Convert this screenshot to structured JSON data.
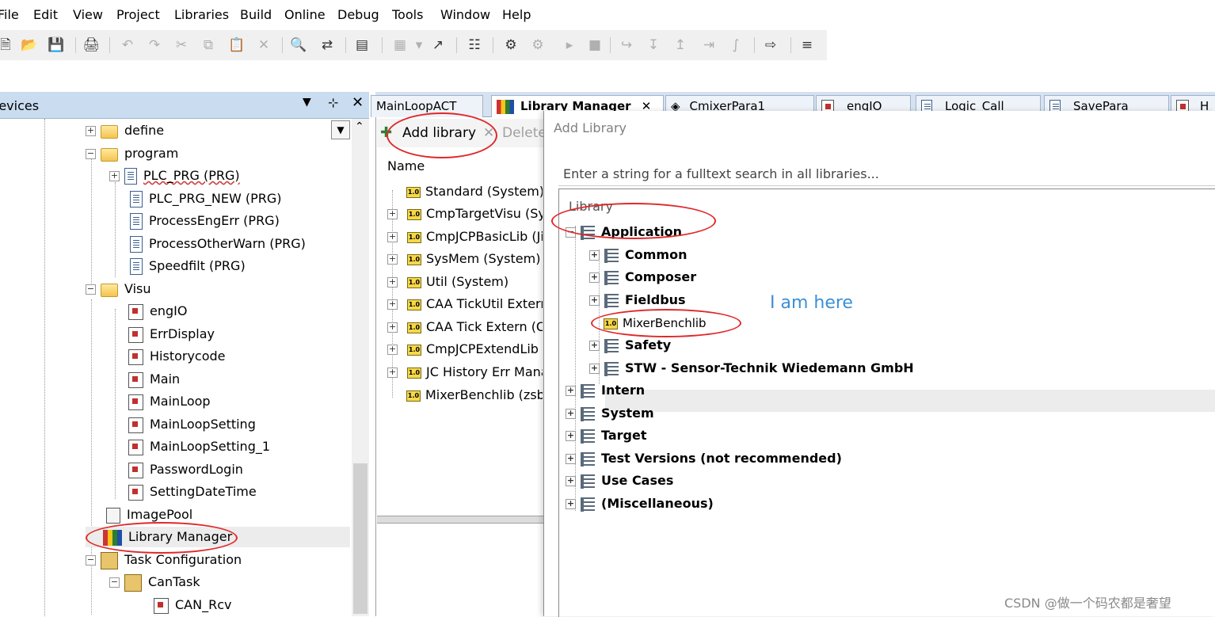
{
  "menubar": {
    "items": [
      "File",
      "Edit",
      "View",
      "Project",
      "Libraries",
      "Build",
      "Online",
      "Debug",
      "Tools",
      "Window",
      "Help"
    ]
  },
  "devices_panel": {
    "title": "Devices",
    "items": [
      {
        "label": "define"
      },
      {
        "label": "program"
      },
      {
        "label": "PLC_PRG (PRG)"
      },
      {
        "label": "PLC_PRG_NEW (PRG)"
      },
      {
        "label": "ProcessEngErr (PRG)"
      },
      {
        "label": "ProcessOtherWarn (PRG)"
      },
      {
        "label": "Speedfilt (PRG)"
      },
      {
        "label": "Visu"
      },
      {
        "label": "engIO"
      },
      {
        "label": "ErrDisplay"
      },
      {
        "label": "Historycode"
      },
      {
        "label": "Main"
      },
      {
        "label": "MainLoop"
      },
      {
        "label": "MainLoopSetting"
      },
      {
        "label": "MainLoopSetting_1"
      },
      {
        "label": "PasswordLogin"
      },
      {
        "label": "SettingDateTime"
      },
      {
        "label": "ImagePool"
      },
      {
        "label": "Library Manager"
      },
      {
        "label": "Task Configuration"
      },
      {
        "label": "CanTask"
      },
      {
        "label": "CAN_Rcv"
      }
    ]
  },
  "editor_tabs": [
    "MainLoopACT",
    "Library Manager",
    "CmixerPara1",
    "engIO",
    "Logic_Call",
    "SavePara",
    "H"
  ],
  "library_manager": {
    "add_label": "Add library",
    "delete_label": "Delete",
    "column_name": "Name",
    "libraries": [
      "Standard (System)",
      "CmpTargetVisu (Sys",
      "CmpJCPBasicLib (Jia",
      "SysMem (System)",
      "Util (System)",
      "CAA TickUtil Extern",
      "CAA Tick Extern (CA",
      "CmpJCPExtendLib (",
      "JC History Err Mana",
      "MixerBenchlib (zsb)"
    ]
  },
  "add_library_dialog": {
    "title": "Add Library",
    "search_placeholder": "Enter a string for a fulltext search in all libraries...",
    "tree_header": "Library",
    "groups": {
      "application": "Application",
      "common": "Common",
      "composer": "Composer",
      "fieldbus": "Fieldbus",
      "mixerbenchlib": "MixerBenchlib",
      "safety": "Safety",
      "stw": "STW - Sensor-Technik Wiedemann GmbH",
      "intern": "Intern",
      "system": "System",
      "target": "Target",
      "test_versions": "Test Versions (not recommended)",
      "use_cases": "Use Cases",
      "misc": "(Miscellaneous)"
    }
  },
  "annotation": {
    "label": "I am here"
  },
  "watermark": "CSDN @做一个码农都是奢望",
  "colors": {
    "annotation_red": "#e0282a",
    "annotation_blue": "#3b8fd6",
    "panel_header": "#c9dcf0",
    "selection": "#ececec"
  }
}
